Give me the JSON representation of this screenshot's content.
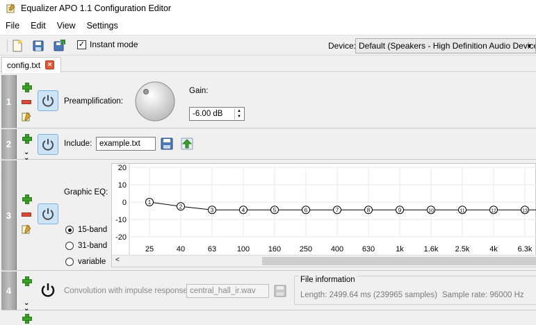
{
  "window": {
    "title": "Equalizer APO 1.1 Configuration Editor"
  },
  "menu": [
    "File",
    "Edit",
    "View",
    "Settings"
  ],
  "toolbar": {
    "instant_mode_label": "Instant mode",
    "instant_mode_checked": true,
    "device_label": "Device:",
    "device_value": "Default (Speakers - High Definition Audio Device)"
  },
  "tab": {
    "label": "config.txt"
  },
  "filters": [
    {
      "number": "1",
      "label": "Preamplification:",
      "gain_label": "Gain:",
      "gain_value": "-6.00 dB"
    },
    {
      "number": "2",
      "label": "Include:",
      "value": "example.txt"
    },
    {
      "number": "3",
      "label": "Graphic EQ:",
      "radios": [
        "15-band",
        "31-band",
        "variable"
      ],
      "selected": "15-band"
    },
    {
      "number": "4",
      "label": "Convolution with impulse response:",
      "value": "central_hall_ir.wav",
      "file_info_title": "File information",
      "length": "Length:  2499.64 ms (239965 samples)",
      "sample_rate": "Sample rate:  96000 Hz"
    }
  ],
  "chart_data": {
    "type": "line",
    "y_ticks": [
      "20",
      "10",
      "0",
      "-10",
      "-20"
    ],
    "ylim": [
      -20,
      20
    ],
    "categories": [
      "25",
      "40",
      "63",
      "100",
      "160",
      "250",
      "400",
      "630",
      "1k",
      "1.6k",
      "2.5k",
      "4k",
      "6.3k"
    ],
    "values": [
      0,
      -2.5,
      -4.5,
      -4.5,
      -4.5,
      -4.5,
      -4.5,
      -4.5,
      -4.5,
      -4.5,
      -4.5,
      -4.5,
      -4.5
    ],
    "point_labels": [
      "1",
      "2",
      "3",
      "4",
      "5",
      "6",
      "7",
      "8",
      "9",
      "10",
      "11",
      "12",
      "13"
    ]
  }
}
